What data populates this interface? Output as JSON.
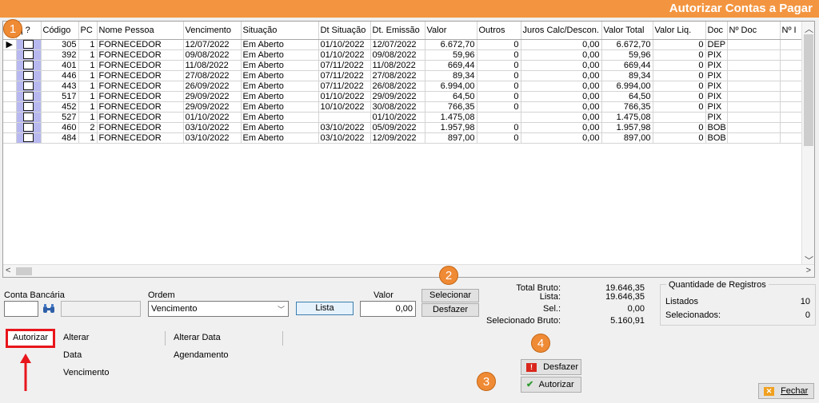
{
  "window": {
    "title": "Autorizar Contas a Pagar"
  },
  "grid": {
    "columns": [
      "q ?",
      "Código",
      "PC",
      "Nome Pessoa",
      "Vencimento",
      "Situação",
      "Dt Situação",
      "Dt. Emissão",
      "Valor",
      "Outros",
      "Juros Calc/Descon.",
      "Valor Total",
      "Valor Liq.",
      "Doc",
      "Nº Doc",
      "Nº I"
    ],
    "rows": [
      {
        "codigo": "305",
        "pc": "1",
        "nome": "FORNECEDOR",
        "vencimento": "12/07/2022",
        "situacao": "Em Aberto",
        "dt_situacao": "01/10/2022",
        "dt_emissao": "12/07/2022",
        "valor": "6.672,70",
        "outros": "0",
        "juros": "0,00",
        "valor_total": "6.672,70",
        "valor_liq": "0",
        "doc": "DEP"
      },
      {
        "codigo": "392",
        "pc": "1",
        "nome": "FORNECEDOR",
        "vencimento": "09/08/2022",
        "situacao": "Em Aberto",
        "dt_situacao": "01/10/2022",
        "dt_emissao": "09/08/2022",
        "valor": "59,96",
        "outros": "0",
        "juros": "0,00",
        "valor_total": "59,96",
        "valor_liq": "0",
        "doc": "PIX"
      },
      {
        "codigo": "401",
        "pc": "1",
        "nome": "FORNECEDOR",
        "vencimento": "11/08/2022",
        "situacao": "Em Aberto",
        "dt_situacao": "07/11/2022",
        "dt_emissao": "11/08/2022",
        "valor": "669,44",
        "outros": "0",
        "juros": "0,00",
        "valor_total": "669,44",
        "valor_liq": "0",
        "doc": "PIX"
      },
      {
        "codigo": "446",
        "pc": "1",
        "nome": "FORNECEDOR",
        "vencimento": "27/08/2022",
        "situacao": "Em Aberto",
        "dt_situacao": "07/11/2022",
        "dt_emissao": "27/08/2022",
        "valor": "89,34",
        "outros": "0",
        "juros": "0,00",
        "valor_total": "89,34",
        "valor_liq": "0",
        "doc": "PIX"
      },
      {
        "codigo": "443",
        "pc": "1",
        "nome": "FORNECEDOR",
        "vencimento": "26/09/2022",
        "situacao": "Em Aberto",
        "dt_situacao": "07/11/2022",
        "dt_emissao": "26/08/2022",
        "valor": "6.994,00",
        "outros": "0",
        "juros": "0,00",
        "valor_total": "6.994,00",
        "valor_liq": "0",
        "doc": "PIX"
      },
      {
        "codigo": "517",
        "pc": "1",
        "nome": "FORNECEDOR",
        "vencimento": "29/09/2022",
        "situacao": "Em Aberto",
        "dt_situacao": "01/10/2022",
        "dt_emissao": "29/09/2022",
        "valor": "64,50",
        "outros": "0",
        "juros": "0,00",
        "valor_total": "64,50",
        "valor_liq": "0",
        "doc": "PIX"
      },
      {
        "codigo": "452",
        "pc": "1",
        "nome": "FORNECEDOR",
        "vencimento": "29/09/2022",
        "situacao": "Em Aberto",
        "dt_situacao": "10/10/2022",
        "dt_emissao": "30/08/2022",
        "valor": "766,35",
        "outros": "0",
        "juros": "0,00",
        "valor_total": "766,35",
        "valor_liq": "0",
        "doc": "PIX"
      },
      {
        "codigo": "527",
        "pc": "1",
        "nome": "FORNECEDOR",
        "vencimento": "01/10/2022",
        "situacao": "Em Aberto",
        "dt_situacao": "",
        "dt_emissao": "01/10/2022",
        "valor": "1.475,08",
        "outros": "",
        "juros": "0,00",
        "valor_total": "1.475,08",
        "valor_liq": "",
        "doc": "PIX"
      },
      {
        "codigo": "460",
        "pc": "2",
        "nome": "FORNECEDOR",
        "vencimento": "03/10/2022",
        "situacao": "Em Aberto",
        "dt_situacao": "03/10/2022",
        "dt_emissao": "05/09/2022",
        "valor": "1.957,98",
        "outros": "0",
        "juros": "0,00",
        "valor_total": "1.957,98",
        "valor_liq": "0",
        "doc": "BOB"
      },
      {
        "codigo": "484",
        "pc": "1",
        "nome": "FORNECEDOR",
        "vencimento": "03/10/2022",
        "situacao": "Em Aberto",
        "dt_situacao": "03/10/2022",
        "dt_emissao": "12/09/2022",
        "valor": "897,00",
        "outros": "0",
        "juros": "0,00",
        "valor_total": "897,00",
        "valor_liq": "0",
        "doc": "BOB"
      }
    ]
  },
  "filters": {
    "conta_label": "Conta Bancária",
    "conta_value": "",
    "conta_desc": "",
    "ordem_label": "Ordem",
    "ordem_value": "Vencimento",
    "lista_label": "Lista",
    "valor_label": "Valor",
    "valor_value": "0,00",
    "selecionar_label": "Selecionar",
    "desfazer_label": "Desfazer"
  },
  "totals": {
    "total_bruto_label": "Total Bruto:",
    "total_bruto": "19.646,35",
    "lista_label": "Lista:",
    "lista": "19.646,35",
    "sel_label": "Sel.:",
    "sel": "0,00",
    "selecionado_bruto_label": "Selecionado Bruto:",
    "selecionado_bruto": "5.160,91"
  },
  "registros": {
    "title": "Quantidade de Registros",
    "listados_label": "Listados",
    "listados": "10",
    "selecionados_label": "Selecionados:",
    "selecionados": "0"
  },
  "tabs": [
    "Autorizar",
    "Alterar Data Vencimento",
    "Alterar Data Agendamento"
  ],
  "actions": {
    "desfazer": "Desfazer",
    "autorizar": "Autorizar",
    "fechar": "Fechar"
  },
  "annotations": [
    "1",
    "2",
    "3",
    "4"
  ],
  "colors": {
    "titlebar": "#f39540",
    "badge": "#ef8a35",
    "highlight": "#e8151b",
    "checkbox_col": "#b8b8f0"
  }
}
